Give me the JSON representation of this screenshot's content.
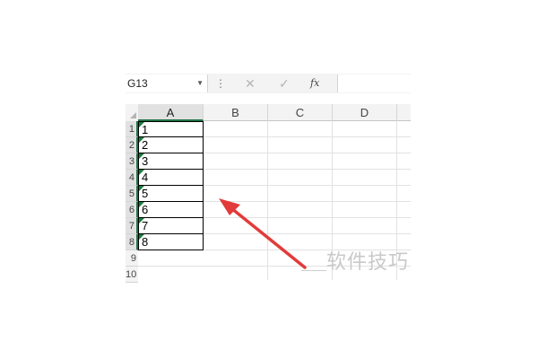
{
  "formula_bar": {
    "name_box": "G13",
    "separator": "⋮",
    "cancel_icon": "✕",
    "enter_icon": "✓",
    "fx_label": "fx",
    "formula_value": ""
  },
  "columns": [
    "A",
    "B",
    "C",
    "D"
  ],
  "rows": [
    {
      "number": "1",
      "value": "1"
    },
    {
      "number": "2",
      "value": "2"
    },
    {
      "number": "3",
      "value": "3"
    },
    {
      "number": "4",
      "value": "4"
    },
    {
      "number": "5",
      "value": "5"
    },
    {
      "number": "6",
      "value": "6"
    },
    {
      "number": "7",
      "value": "7"
    },
    {
      "number": "8",
      "value": "8"
    },
    {
      "number": "9",
      "value": ""
    },
    {
      "number": "10",
      "value": ""
    }
  ],
  "watermark": "软件技巧",
  "colors": {
    "accent": "#217346",
    "error_triangle": "#1b7a3c",
    "arrow": "#e23b3b"
  }
}
